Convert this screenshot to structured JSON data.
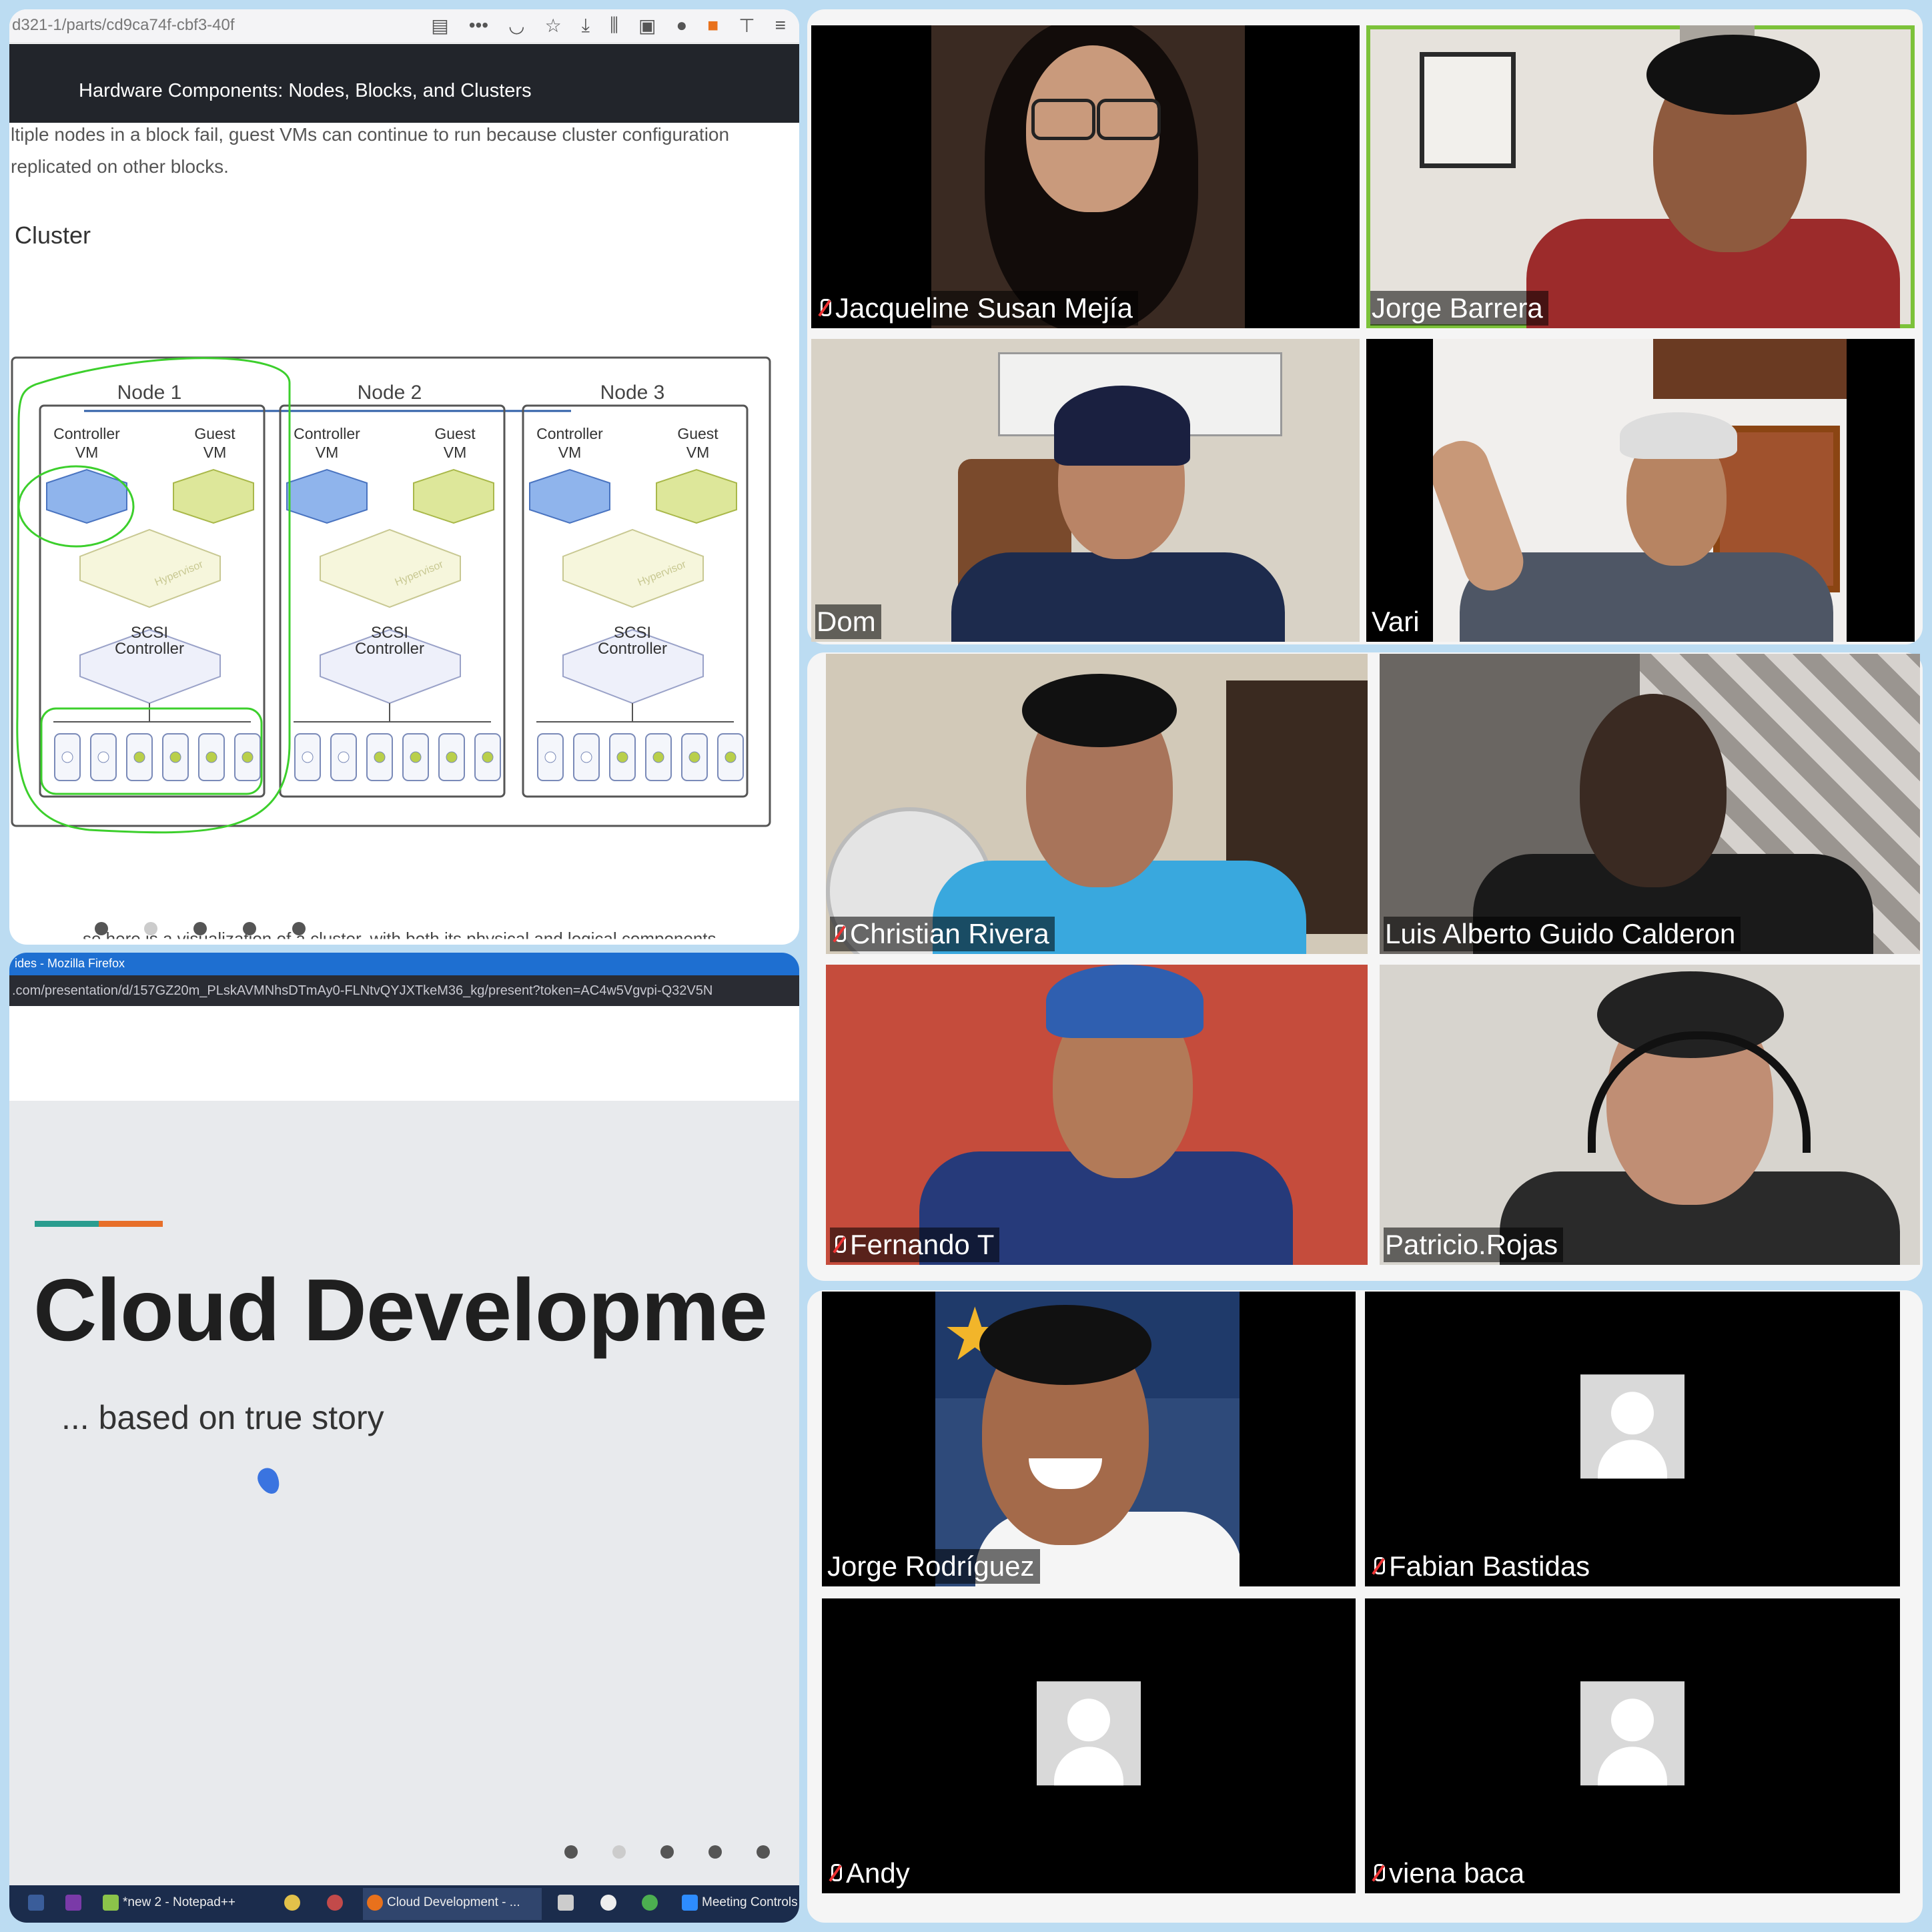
{
  "browser_top": {
    "url_fragment": "d321-1/parts/cd9ca74f-cbf3-40f",
    "header_title": "Hardware Components: Nodes, Blocks, and Clusters",
    "text_line1": "ltiple nodes in a block fail, guest VMs can continue to run because cluster configuration",
    "text_line2": "replicated on other blocks.",
    "section_heading": "Cluster",
    "bottom_text": "se here is a visualization of a cluster, with both its physical and logical components",
    "diagram": {
      "nodes": [
        {
          "title": "Node 1"
        },
        {
          "title": "Node 2"
        },
        {
          "title": "Node 3"
        }
      ],
      "controller_vm": "Controller VM",
      "guest_vm": "Guest VM",
      "hypervisor": "Hypervisor",
      "scsi": "SCSI",
      "controller": "Controller"
    }
  },
  "browser_bottom": {
    "window_title": "ides - Mozilla Firefox",
    "url": ".com/presentation/d/157GZ20m_PLskAVMNhsDTmAy0-FLNtvQYJXTkeM36_kg/present?token=AC4w5Vgvpi-Q32V5N",
    "slide_title": "Cloud Developme",
    "slide_subtitle": "... based on true story",
    "accent_colors": [
      "#2a9d8f",
      "#e76f2a"
    ],
    "taskbar": {
      "notepad": "*new 2 - Notepad++",
      "firefox": "Cloud Development - ...",
      "meeting": "Meeting Controls"
    }
  },
  "participants": [
    {
      "name": "Jacqueline Susan Mejía",
      "muted": true,
      "video": true
    },
    {
      "name": "Jorge Barrera",
      "muted": false,
      "video": true,
      "active_speaker": true
    },
    {
      "name": "Dom",
      "muted": false,
      "video": true
    },
    {
      "name": "Vari",
      "muted": false,
      "video": true
    },
    {
      "name": "Christian Rivera",
      "muted": true,
      "video": true
    },
    {
      "name": "Luis Alberto Guido Calderon",
      "muted": false,
      "video": true
    },
    {
      "name": "Fernando T",
      "muted": true,
      "video": true
    },
    {
      "name": "Patricio.Rojas",
      "muted": false,
      "video": true
    },
    {
      "name": "Jorge Rodríguez",
      "muted": false,
      "video": true
    },
    {
      "name": "Fabian Bastidas",
      "muted": true,
      "video": false
    },
    {
      "name": "Andy",
      "muted": true,
      "video": false
    },
    {
      "name": "viena baca",
      "muted": true,
      "video": false
    }
  ]
}
